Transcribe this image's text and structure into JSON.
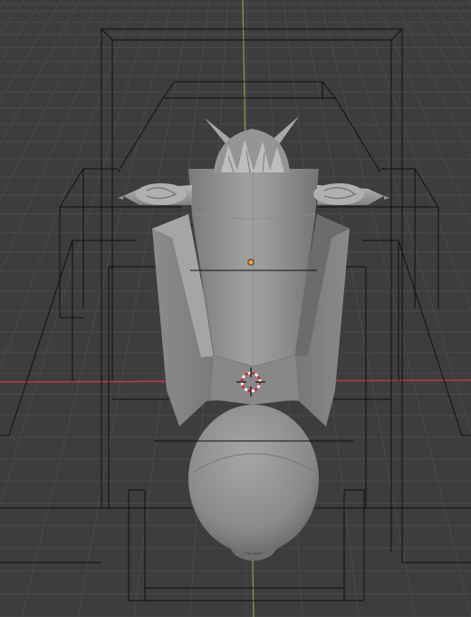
{
  "viewport": {
    "background": "#3d3d3d",
    "grid_color": "#4a4a4a",
    "x_axis_color": "#c0394a",
    "y_axis_color": "#7ea83a",
    "wire_color": "#101010",
    "mesh_base_color": "#8c8c8c",
    "origin_color": "#f0a030",
    "cursor_colors": [
      "#d0283a",
      "#ffffff"
    ]
  },
  "scene": {
    "objects": [
      {
        "kind": "character-mesh",
        "icon": "mesh-icon"
      },
      {
        "kind": "bounding-boxes",
        "icon": "wireframe-icon"
      },
      {
        "kind": "object-origin",
        "icon": "origin-dot-icon"
      },
      {
        "kind": "3d-cursor",
        "icon": "crosshair-icon"
      }
    ]
  }
}
